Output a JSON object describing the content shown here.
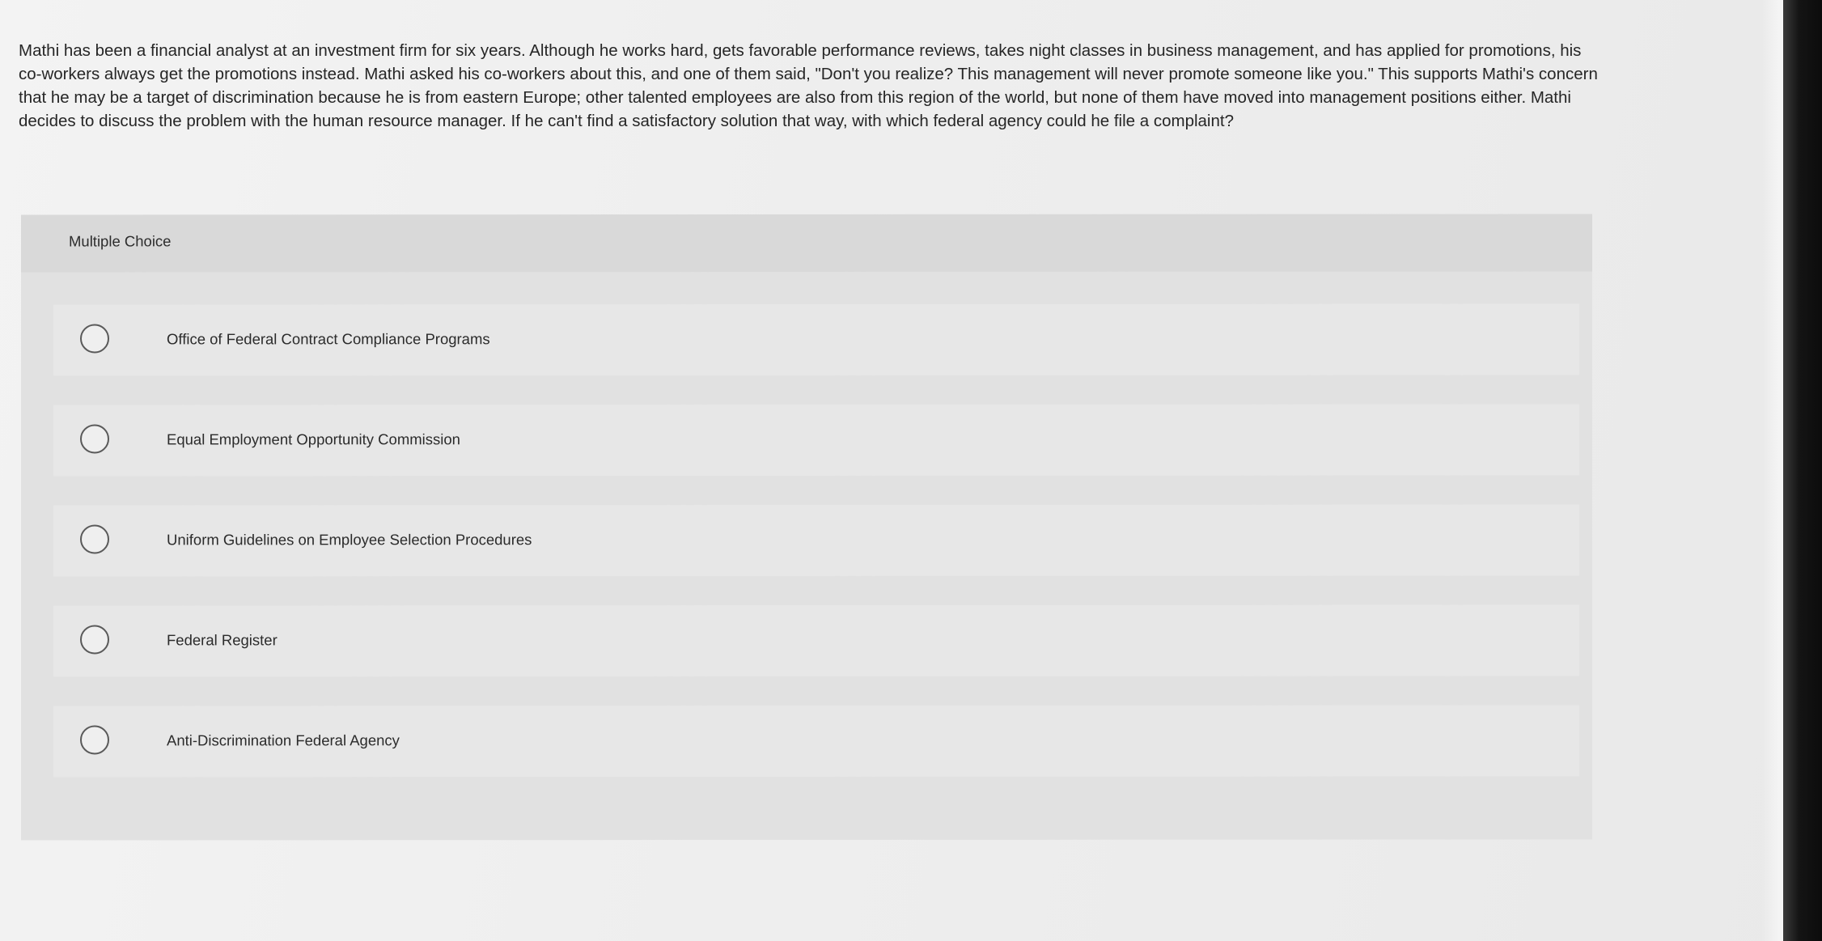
{
  "question": {
    "text": "Mathi has been a financial analyst at an investment firm for six years. Although he works hard, gets favorable performance reviews, takes night classes in business management, and has applied for promotions, his co-workers always get the promotions instead. Mathi asked his co-workers about this, and one of them said, \"Don't you realize? This management will never promote someone like you.\" This supports Mathi's concern that he may be a target of discrimination because he is from eastern Europe; other talented employees are also from this region of the world, but none of them have moved into management positions either. Mathi decides to discuss the problem with the human resource manager. If he can't find a satisfactory solution that way, with which federal agency could he file a complaint?"
  },
  "multiple_choice": {
    "header": "Multiple Choice",
    "options": [
      {
        "label": "Office of Federal Contract Compliance Programs",
        "selected": false
      },
      {
        "label": "Equal Employment Opportunity Commission",
        "selected": false
      },
      {
        "label": "Uniform Guidelines on Employee Selection Procedures",
        "selected": false
      },
      {
        "label": "Federal Register",
        "selected": false
      },
      {
        "label": "Anti-Discrimination Federal Agency",
        "selected": false
      }
    ]
  }
}
